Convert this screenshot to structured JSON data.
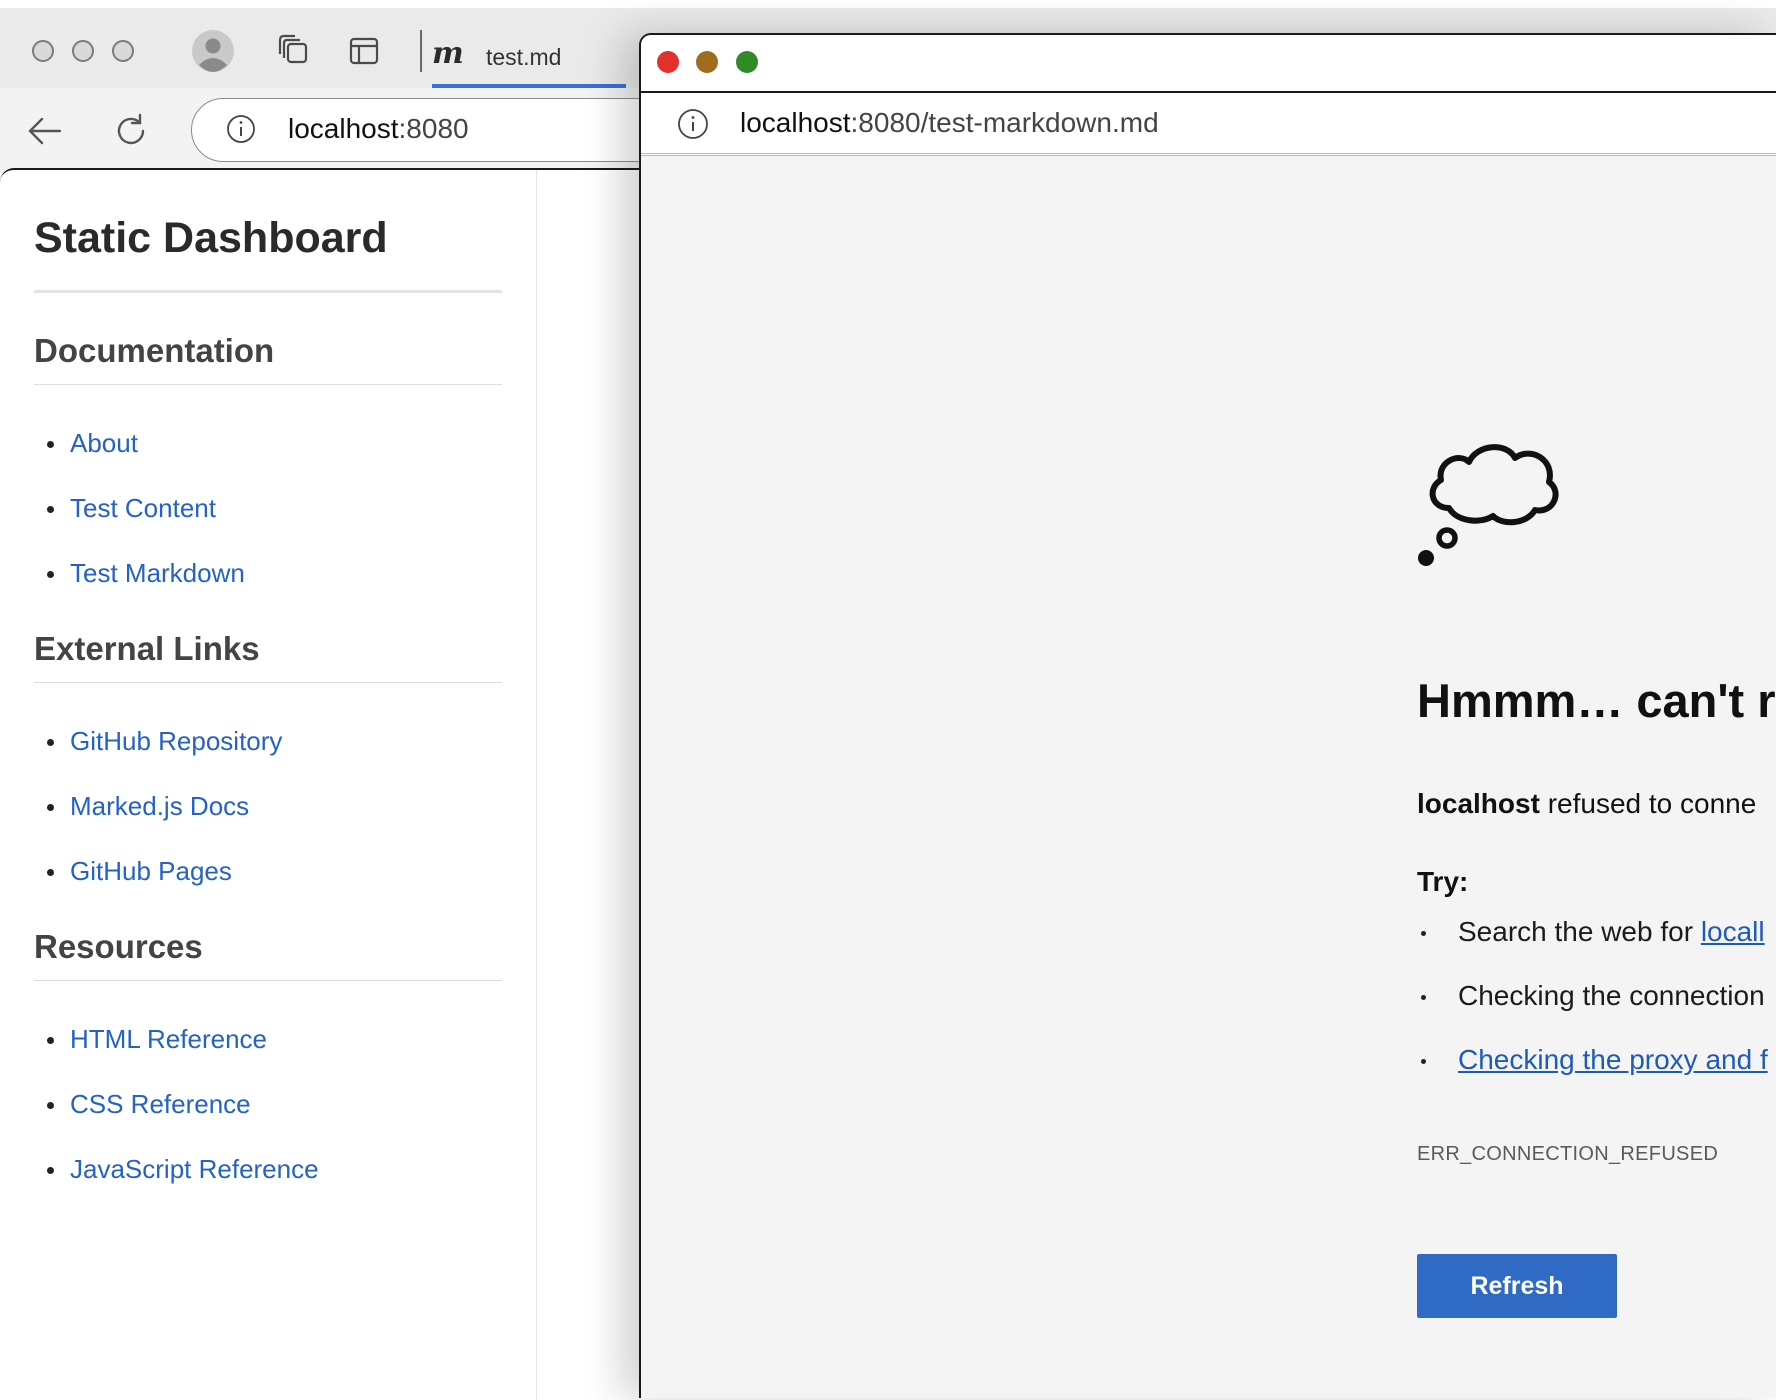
{
  "back_browser": {
    "tab": {
      "logo": "m",
      "title": "test.md"
    },
    "address": {
      "host": "localhost",
      "port": ":8080"
    },
    "sidebar": {
      "title": "Static Dashboard",
      "sections": [
        {
          "title": "Documentation",
          "links": [
            "About",
            "Test Content",
            "Test Markdown"
          ]
        },
        {
          "title": "External Links",
          "links": [
            "GitHub Repository",
            "Marked.js Docs",
            "GitHub Pages"
          ]
        },
        {
          "title": "Resources",
          "links": [
            "HTML Reference",
            "CSS Reference",
            "JavaScript Reference"
          ]
        }
      ]
    }
  },
  "front_window": {
    "traffic_lights": {
      "close": "#e0312b",
      "minimize": "#a06d1f",
      "maximize": "#2f8a27"
    },
    "url": {
      "host": "localhost",
      "rest": ":8080/test-markdown.md"
    },
    "error": {
      "icon": "thought-cloud-icon",
      "title": "Hmmm… can't re",
      "subtitle_host": "localhost",
      "subtitle_rest": " refused to conne",
      "try_label": "Try:",
      "suggestions": [
        {
          "prefix": "Search the web for ",
          "link": "locall"
        },
        {
          "prefix": "Checking the connection",
          "link": ""
        },
        {
          "prefix": "",
          "link": "Checking the proxy and f"
        }
      ],
      "code": "ERR_CONNECTION_REFUSED",
      "refresh_label": "Refresh"
    }
  },
  "colors": {
    "link": "#2462c8",
    "button": "#2f6ac5",
    "tab_underline": "#3a6fd8"
  }
}
